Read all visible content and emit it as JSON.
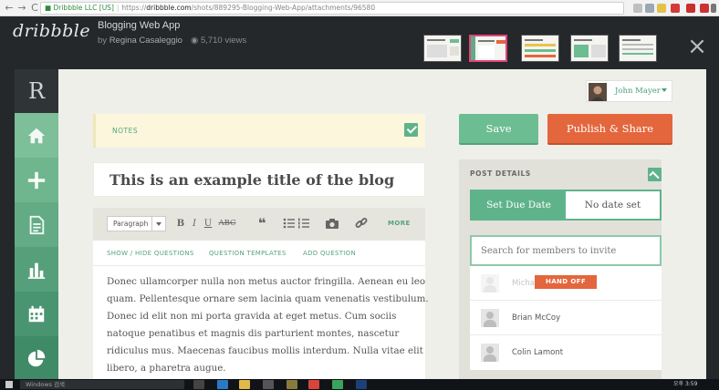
{
  "browser": {
    "nav_back": "←",
    "nav_forward": "→",
    "nav_reload": "C",
    "address_security": "Dribbble LLC [US]",
    "address_url_scheme": "https://",
    "address_url_host": "dribbble.com",
    "address_url_path": "/shots/889295-Blogging-Web-App/attachments/96580"
  },
  "dribbble": {
    "logo": "dribbble",
    "shot_title": "Blogging Web App",
    "by_prefix": "by",
    "author": "Regina Casaleggio",
    "views": "5,710 views",
    "close": "×"
  },
  "app": {
    "brand_letter": "R",
    "sidebar_items": [
      {
        "icon": "home-icon",
        "color": "#7cbf98"
      },
      {
        "icon": "plus-icon",
        "color": "#6fb58d"
      },
      {
        "icon": "document-icon",
        "color": "#62ab85"
      },
      {
        "icon": "bar-chart-icon",
        "color": "#55a07b"
      },
      {
        "icon": "calendar-icon",
        "color": "#4a9571"
      },
      {
        "icon": "pie-chart-icon",
        "color": "#3f8a67"
      }
    ],
    "user_name": "John Mayer",
    "notes_label": "NOTES",
    "post_title": "This is an example title of the blog",
    "toolbar": {
      "format_select": "Paragraph",
      "bold": "B",
      "italic": "I",
      "underline": "U",
      "strike": "ABC",
      "quote": "❝",
      "more": "MORE"
    },
    "question_links": [
      "SHOW / HIDE QUESTIONS",
      "QUESTION TEMPLATES",
      "ADD QUESTION"
    ],
    "body_lines": [
      "Donec ullamcorper nulla non metus auctor fringilla. Aenean eu leo",
      "quam. Pellentesque ornare sem lacinia quam venenatis vestibulum.",
      "Donec id elit non mi porta gravida at eget metus. Cum sociis",
      "natoque penatibus et magnis dis parturient montes, nascetur",
      "ridiculus mus. Maecenas faucibus mollis interdum. Nulla vitae elit",
      "libero, a pharetra augue."
    ],
    "save_label": "Save",
    "publish_label": "Publish & Share",
    "post_details": {
      "title": "POST DETAILS",
      "due_label": "Set Due Date",
      "due_value": "No date set",
      "search_placeholder": "Search for members to invite",
      "members": [
        {
          "name": "Michael",
          "faded": true
        },
        {
          "name": "Brian McCoy",
          "faded": false
        },
        {
          "name": "Colin Lamont",
          "faded": false
        }
      ],
      "handoff_label": "HAND OFF"
    },
    "colors": {
      "accent_green": "#5fb38b",
      "accent_orange": "#e4663d"
    }
  },
  "taskbar": {
    "search_text": "Windows 검색",
    "clock": "오후 3:59"
  }
}
